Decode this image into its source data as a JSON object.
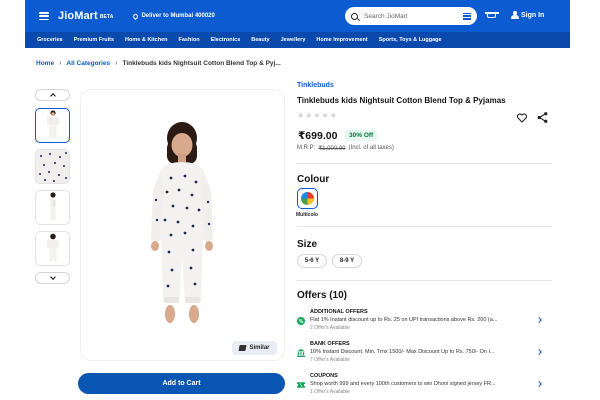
{
  "header": {
    "brand": "JioMart",
    "brand_tag": "BETA",
    "deliver_text": "Deliver to Mumbai 400020",
    "search_placeholder": "Search JioMart",
    "signin_label": "Sign In",
    "accent_color": "#0c5bd1"
  },
  "categories": [
    "Groceries",
    "Premium Fruits",
    "Home & Kitchen",
    "Fashion",
    "Electronics",
    "Beauty",
    "Jewellery",
    "Home Improvement",
    "Sports, Toys & Luggage"
  ],
  "breadcrumb": {
    "home": "Home",
    "all_categories": "All Categories",
    "current": "Tinklebuds kids Nightsuit Cotton Blend Top & Pyj..."
  },
  "product": {
    "brand": "Tinklebuds",
    "title": "Tinklebuds kids Nightsuit Cotton Blend Top & Pyjamas",
    "price": "₹699.00",
    "discount": "30% Off",
    "mrp_label": "M.R.P:",
    "mrp_value": "₹1,000.00",
    "tax_note": "(Incl. of all taxes)",
    "similar_label": "Similar",
    "add_to_cart": "Add to Cart"
  },
  "colour": {
    "heading": "Colour",
    "selected": "Multicolo"
  },
  "size": {
    "heading": "Size",
    "options": [
      "5-6 Y",
      "8-9 Y"
    ]
  },
  "offers": {
    "heading": "Offers (10)",
    "items": [
      {
        "title": "ADDITIONAL OFFERS",
        "desc": "Flat 1% Instant discount up to Rs. 25 on UPI transactions above Rs. 200 (a...",
        "count": "2 Offer's Available",
        "icon": "percent-badge-icon"
      },
      {
        "title": "BANK OFFERS",
        "desc": "10% Instant Discount. Min. Trnx 1500/- Max Discount Up to Rs. 750/- On I...",
        "count": "7 Offer's Available",
        "icon": "bank-icon"
      },
      {
        "title": "COUPONS",
        "desc": "Shop worth 999 and every 100th customers to win Dhoni signed jersey FR...",
        "count": "1 Offer's Available",
        "icon": "coupon-icon"
      }
    ]
  }
}
